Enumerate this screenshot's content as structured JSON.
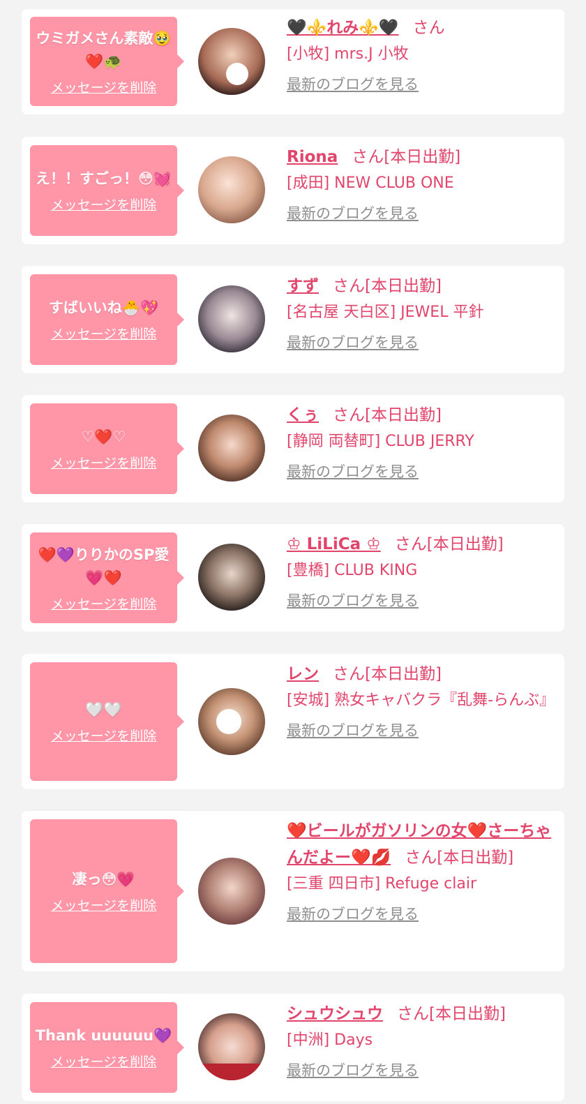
{
  "delete_label": "メッセージを削除",
  "blog_label": "最新のブログを見る",
  "colors": {
    "accent": "#e2456b",
    "bubble": "#ff96a8",
    "background": "#f3f3f3",
    "link_gray": "#8e8e8e"
  },
  "entries": [
    {
      "message": "ウミガメさん素敵🥹❤️🐢",
      "name": "🖤⚜️れみ⚜️🖤",
      "suffix": "さん",
      "shop": "[小牧] mrs.J 小牧"
    },
    {
      "message": "え！！すごっ！😳💓",
      "name": "Riona",
      "suffix": "さん[本日出勤]",
      "shop": "[成田] NEW CLUB ONE"
    },
    {
      "message": "すばいいね🐣💖",
      "name": "すず",
      "suffix": "さん[本日出勤]",
      "shop": "[名古屋 天白区] JEWEL 平針"
    },
    {
      "message": "♡❤️♡",
      "name": "くぅ",
      "suffix": "さん[本日出勤]",
      "shop": "[静岡 両替町] CLUB JERRY"
    },
    {
      "message": "❤️💜りりかのSP愛💗❤️",
      "name": "♔ LiLiCa ♔",
      "suffix": "さん[本日出勤]",
      "shop": "[豊橋] CLUB KING"
    },
    {
      "message": "🤍🤍",
      "name": "レン",
      "suffix": "さん[本日出勤]",
      "shop": "[安城] 熟女キャバクラ『乱舞-らんぶ』"
    },
    {
      "message": "凄っ😳💗",
      "name": "❤️ビールがガソリンの女❤️さーちゃんだよー❤️💋",
      "suffix": "さん[本日出勤]",
      "shop": "[三重 四日市] Refuge clair"
    },
    {
      "message": "Thank uuuuuu💜",
      "name": "シュウシュウ",
      "suffix": "さん[本日出勤]",
      "shop": "[中洲] Days"
    }
  ]
}
